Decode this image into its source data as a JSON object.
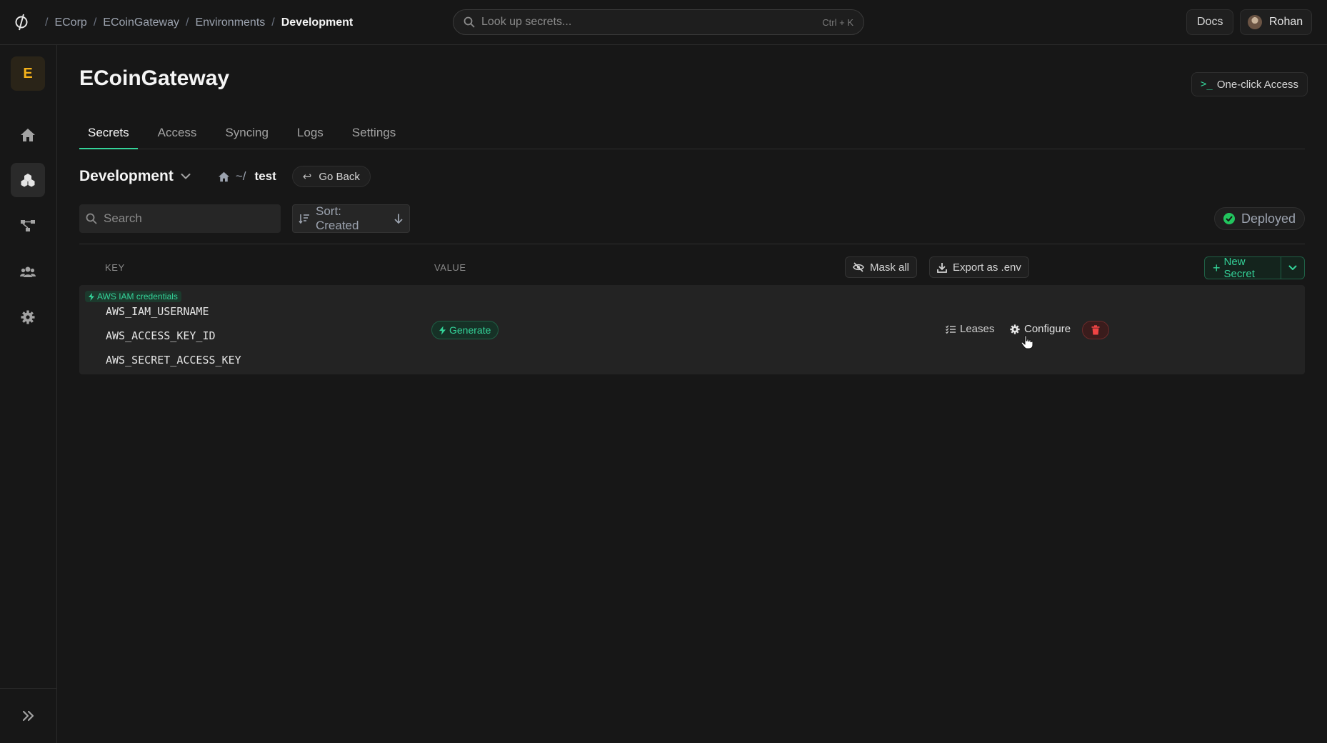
{
  "topbar": {
    "breadcrumbs": [
      "ECorp",
      "ECoinGateway",
      "Environments",
      "Development"
    ],
    "lookup_placeholder": "Look up secrets...",
    "lookup_shortcut": "Ctrl + K",
    "docs_label": "Docs",
    "user_name": "Rohan"
  },
  "sidebar": {
    "org_initial": "E",
    "items": [
      {
        "icon": "home-icon"
      },
      {
        "icon": "apps-icon"
      },
      {
        "icon": "integrations-icon"
      },
      {
        "icon": "members-icon"
      },
      {
        "icon": "settings-icon"
      }
    ],
    "expand_icon": "expand-icon"
  },
  "main": {
    "app_title": "ECoinGateway",
    "one_click_label": "One-click Access",
    "one_click_prompt": ">_",
    "tabs": [
      "Secrets",
      "Access",
      "Syncing",
      "Logs",
      "Settings"
    ],
    "active_tab": "Secrets",
    "environment": "Development",
    "path_prefix": "~/",
    "folder": "test",
    "go_back_label": "Go Back",
    "search_placeholder": "Search",
    "sort_label": "Sort: Created",
    "deployed_label": "Deployed"
  },
  "table": {
    "key_header": "KEY",
    "value_header": "VALUE",
    "mask_all_label": "Mask all",
    "export_label": "Export as .env",
    "new_secret_label": "New Secret",
    "rows": [
      {
        "badge": "AWS IAM credentials",
        "keys": [
          "AWS_IAM_USERNAME",
          "AWS_ACCESS_KEY_ID",
          "AWS_SECRET_ACCESS_KEY"
        ],
        "generate_label": "Generate",
        "leases_label": "Leases",
        "configure_label": "Configure"
      }
    ]
  },
  "colors": {
    "accent": "#34d399",
    "brand": "#f5b21b",
    "danger": "#ef4444",
    "background": "#171717"
  }
}
